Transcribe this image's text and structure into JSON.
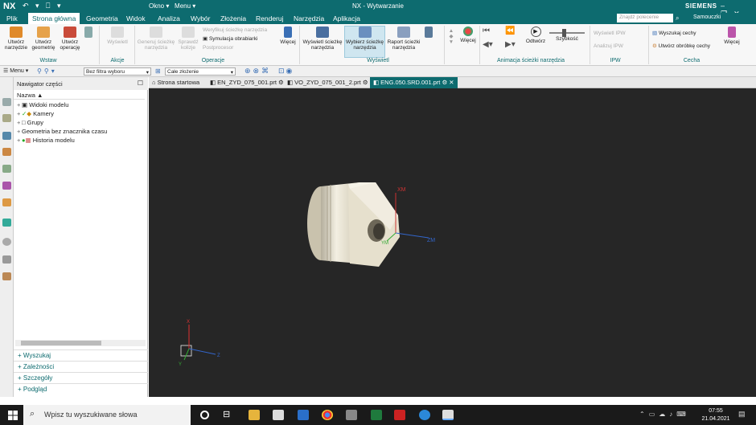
{
  "app": {
    "logo": "NX",
    "title": "NX - Wytwarzanie",
    "brand": "SIEMENS",
    "quick_access": "↶ ▾ ⎕ ▾",
    "window_menu": "Okno ▾",
    "menu_menu": "Menu ▾"
  },
  "ribbon_tabs": [
    "Plik",
    "Strona główna",
    "Geometria",
    "Widok",
    "Analiza",
    "Wybór",
    "Złożenia",
    "Renderuj",
    "Narzędzia",
    "Aplikacja"
  ],
  "search_placeholder": "Znajdź polecenie",
  "user_label": "Samouczki",
  "ribbon": {
    "btn_create_tool": "Utwórz\nnarzędzie",
    "btn_create_geometry": "Utwórz\ngeometrię",
    "btn_create_operation": "Utwórz\noperację",
    "btn_resolve": "Wyświetl",
    "btn_generate": "Generuj ścieżkę\nnarzędzia",
    "btn_verify_tool": "Sprawdź\nkolizje",
    "btn_verify_path": "Weryfikuj ścieżkę narzędzia",
    "btn_simulate": "Symulacja obrabiarki",
    "btn_postprocess": "Postprocesor",
    "btn_more1": "Więcej",
    "btn_show_path": "Wyświetl ścieżkę\nnarzędzia",
    "btn_select_path": "Wybierz ścieżkę\nnarzędzia",
    "btn_report": "Raport ścieżki\nnarzędzia",
    "btn_more2": "Więcej",
    "btn_play": "Odtwórz",
    "btn_speed": "Szybkość",
    "btn_show_ipw": "Wyświetl IPW",
    "btn_analyze_ipw": "Analizuj IPW",
    "btn_find_features": "Wyszukaj cechy",
    "btn_create_feature": "Utwórz obróbkę cechy",
    "btn_more3": "Więcej",
    "group_insert": "Wstaw",
    "group_actions": "Akcje",
    "group_operations": "Operacje",
    "group_display": "Wyświetl",
    "group_animation": "Animacja ścieżki narzędzia",
    "group_ipw": "IPW",
    "group_feature": "Cecha"
  },
  "toolbar2": {
    "menu_label": "Menu ▾",
    "filter_label": "Bez filtra wyboru",
    "assembly_label": "Całe złożenie"
  },
  "navigator": {
    "title": "Nawigator części",
    "column": "Nazwa",
    "items": [
      "Widoki modelu",
      "Kamery",
      "Grupy",
      "Geometria bez znacznika czasu",
      "Historia modelu"
    ],
    "sections": [
      "Wyszukaj",
      "Zależności",
      "Szczegóły",
      "Podgląd"
    ]
  },
  "doc_tabs": [
    "Strona startowa",
    "EN_ZYD_075_001.prt",
    "VO_ZYD_075_001_2.prt",
    "ENG.050.SRD.001.prt"
  ],
  "viewport": {
    "axis_xm": "XM",
    "axis_ym": "YM",
    "axis_zm": "ZM",
    "triad_x": "X",
    "triad_y": "Y",
    "triad_z": "Z"
  },
  "taskbar": {
    "search_placeholder": "Wpisz tu wyszukiwane słowa",
    "time": "07:55",
    "date": "21.04.2021"
  },
  "colors": {
    "accent": "#0d6b6f",
    "viewport_bg": "#262626",
    "part": "#ece6d3"
  }
}
